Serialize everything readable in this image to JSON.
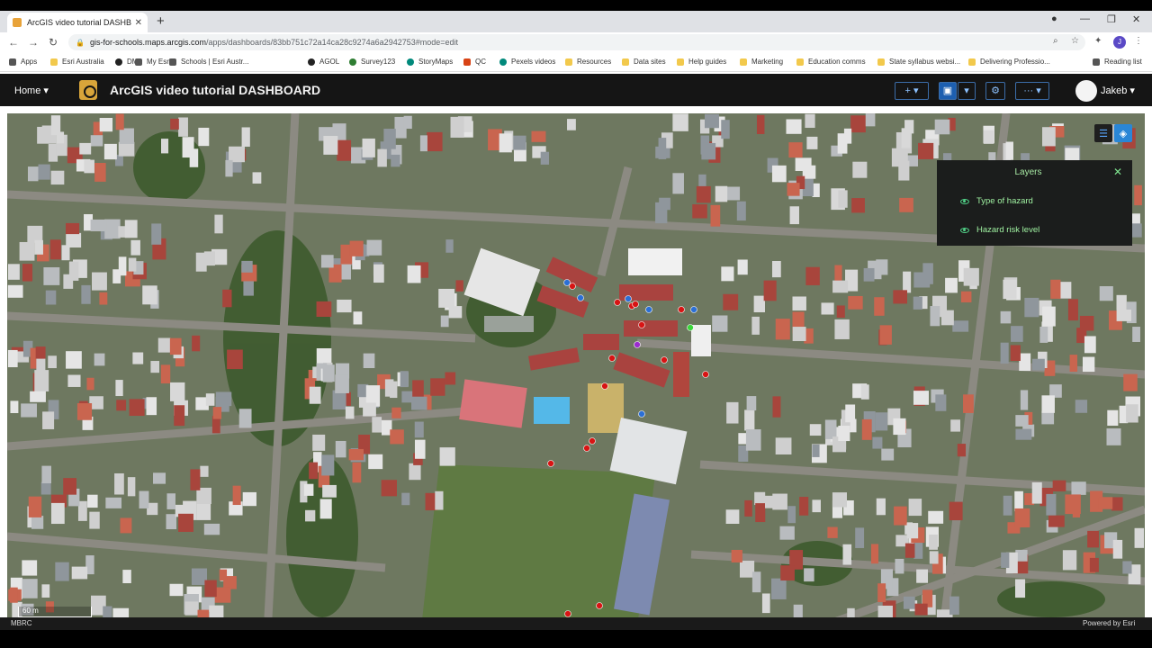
{
  "browser": {
    "tab_title": "ArcGIS video tutorial DASHBOARD",
    "url_host": "gis-for-schools.maps.arcgis.com",
    "url_path": "/apps/dashboards/83bb751c72a14ca28c9274a6a2942753#mode=edit",
    "profile_initial": "J",
    "bookmarks": [
      "Apps",
      "Esri Australia",
      "DM",
      "My Esri",
      "Schools | Esri Austr...",
      "AGOL",
      "Survey123",
      "StoryMaps",
      "QC",
      "Pexels videos",
      "Resources",
      "Data sites",
      "Help guides",
      "Marketing",
      "Education comms",
      "State syllabus websi...",
      "Delivering Professio..."
    ],
    "reading_list": "Reading list"
  },
  "dashboard": {
    "home_label": "Home",
    "title": "ArcGIS video tutorial DASHBOARD",
    "user": "Jakeb",
    "add_label": "+",
    "more_label": "···"
  },
  "layers_panel": {
    "title": "Layers",
    "items": [
      {
        "label": "Type of hazard",
        "visible": true
      },
      {
        "label": "Hazard risk level",
        "visible": true
      }
    ]
  },
  "map": {
    "scale_label": "60 m",
    "source_label": "MBRC",
    "attribution": "Powered by Esri",
    "marker_colors": {
      "red": "#d81414",
      "blue": "#2b6fd6",
      "green": "#3ad63a",
      "purple": "#9b2ccf"
    }
  },
  "colors": {
    "header_bg": "#151515",
    "accent_blue": "#1d5fb0",
    "panel_text": "#9ef0a0"
  }
}
